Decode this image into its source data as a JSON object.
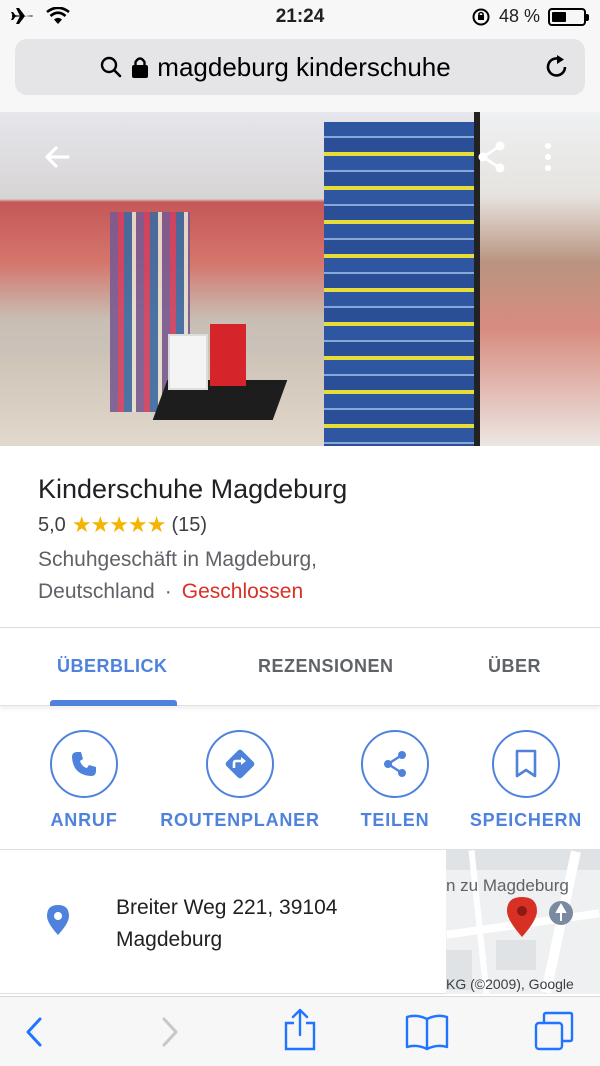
{
  "status_bar": {
    "time": "21:24",
    "battery_percent": "48 %",
    "battery_level": 0.48,
    "icons": [
      "airplane-icon",
      "wifi-icon",
      "orientation-lock-icon",
      "battery-icon"
    ]
  },
  "browser": {
    "url_text": "magdeburg kinderschuhe",
    "icons": [
      "search-icon",
      "lock-icon",
      "reload-icon"
    ]
  },
  "place": {
    "title": "Kinderschuhe Magdeburg",
    "rating": "5,0",
    "stars": "★★★★★",
    "star_count": 5,
    "review_count": "(15)",
    "category_line": "Schuhgeschäft in Magdeburg,",
    "country": "Deutschland",
    "separator": "·",
    "status": "Geschlossen"
  },
  "tabs": [
    {
      "label": "ÜBERBLICK",
      "active": true
    },
    {
      "label": "REZENSIONEN",
      "active": false
    },
    {
      "label": "ÜBER",
      "active": false
    }
  ],
  "actions": [
    {
      "label": "ANRUF",
      "icon": "phone-icon"
    },
    {
      "label": "ROUTENPLANER",
      "icon": "directions-icon"
    },
    {
      "label": "TEILEN",
      "icon": "share-icon"
    },
    {
      "label": "SPEICHERN",
      "icon": "bookmark-icon"
    }
  ],
  "address": {
    "line1": "Breiter Weg 221, 39104",
    "line2": "Magdeburg",
    "map_label": "n zu Magdeburg",
    "map_copyright": "KG (©2009), Google"
  },
  "colors": {
    "accent": "#4f82dc",
    "closed": "#d93025",
    "star": "#f4b400",
    "pin": "#4f82dc",
    "map_pin": "#d93025"
  }
}
